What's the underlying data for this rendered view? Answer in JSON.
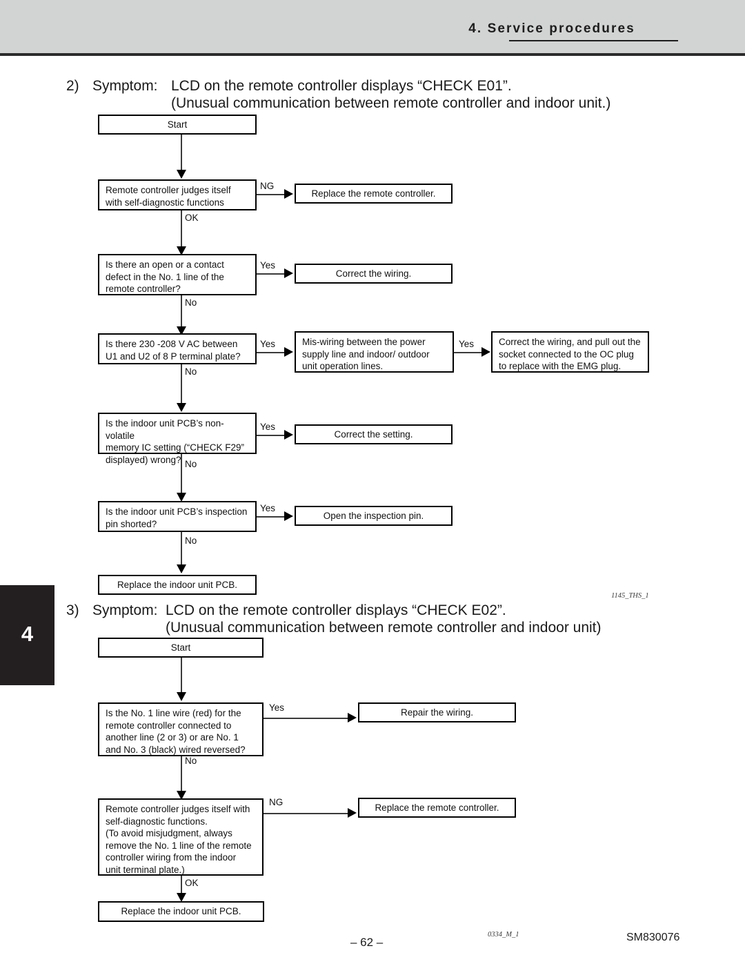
{
  "header": {
    "title": "4. Service procedures"
  },
  "chapter_tab": {
    "number": "4"
  },
  "sections": [
    {
      "number": "2)",
      "label": "Symptom:",
      "line1": "LCD on the remote controller displays “CHECK E01”.",
      "line2": "(Unusual communication between remote controller and indoor unit.)",
      "figure_ref": "1145_THS_1",
      "boxes": {
        "start": "Start",
        "q1": "Remote controller judges itself\nwith self-diagnostic functions",
        "a1": "Replace the remote controller.",
        "q2": "Is there an open or a contact\ndefect in the No. 1 line of the\nremote controller?",
        "a2": "Correct the wiring.",
        "q3": "Is there 230 -208 V AC between\nU1 and U2 of 8 P terminal plate?",
        "a3": "Mis-wiring between the power\nsupply line and indoor/ outdoor\nunit operation lines.",
        "a3b": "Correct the wiring, and pull out the\nsocket connected to the OC plug\nto replace with the EMG plug.",
        "q4": "Is the indoor unit PCB’s non-volatile\nmemory IC setting (“CHECK F29”\ndisplayed) wrong?",
        "a4": "Correct the setting.",
        "q5": "Is the indoor unit PCB’s inspection\npin shorted?",
        "a5": "Open the inspection pin.",
        "end": "Replace the indoor unit PCB."
      },
      "edges": {
        "ng1": "NG",
        "ok1": "OK",
        "yes2": "Yes",
        "no2": "No",
        "yes3": "Yes",
        "yes3b": "Yes",
        "no3": "No",
        "yes4": "Yes",
        "no4": "No",
        "yes5": "Yes",
        "no5": "No"
      }
    },
    {
      "number": "3)",
      "label": "Symptom:",
      "line1": "LCD on the remote controller displays “CHECK E02”.",
      "line2": "(Unusual communication between remote controller and indoor unit)",
      "figure_ref": "0334_M_1",
      "boxes": {
        "start": "Start",
        "q1": "Is the No. 1 line wire (red) for the\nremote controller connected to\nanother line (2 or 3) or are No. 1\nand No. 3 (black) wired reversed?",
        "a1": "Repair the wiring.",
        "q2": "Remote controller judges itself with\nself-diagnostic functions.\n(To avoid misjudgment, always\nremove the No. 1 line of the remote\ncontroller wiring from the indoor\nunit terminal plate.)",
        "a2": "Replace the remote controller.",
        "end": "Replace the indoor unit PCB."
      },
      "edges": {
        "yes1": "Yes",
        "no1": "No",
        "ng2": "NG",
        "ok2": "OK"
      }
    }
  ],
  "footer": {
    "page_number": "– 62 –",
    "document_code": "SM830076"
  }
}
